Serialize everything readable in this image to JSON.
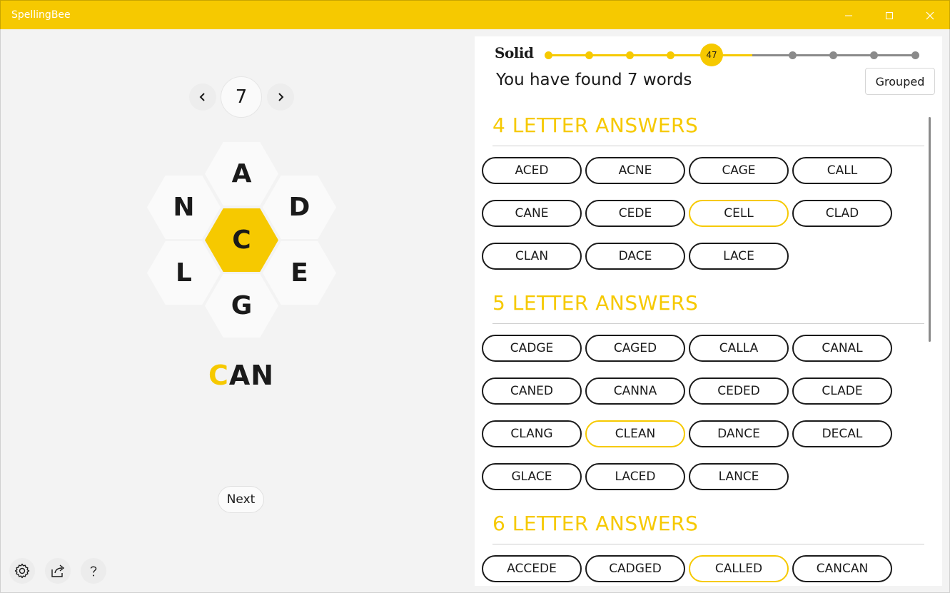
{
  "window": {
    "title": "SpellingBee"
  },
  "left": {
    "puzzle_number": "7",
    "letters": {
      "top": "A",
      "upper_left": "N",
      "upper_right": "D",
      "center": "C",
      "lower_left": "L",
      "lower_right": "E",
      "bottom": "G"
    },
    "current_word": {
      "first_letter": "C",
      "rest": "AN"
    },
    "next_label": "Next"
  },
  "right": {
    "rank": "Solid",
    "score": "47",
    "found_text": "You have found 7 words",
    "grouped_label": "Grouped",
    "progress": {
      "steps": 10,
      "current_step": 5
    },
    "sections": [
      {
        "title": "4 LETTER ANSWERS",
        "words": [
          "ACED",
          "ACNE",
          "CAGE",
          "CALL",
          "CANE",
          "CEDE",
          "CELL",
          "CLAD",
          "CLAN",
          "DACE",
          "LACE"
        ],
        "highlighted": [
          "CELL"
        ]
      },
      {
        "title": "5 LETTER ANSWERS",
        "words": [
          "CADGE",
          "CAGED",
          "CALLA",
          "CANAL",
          "CANED",
          "CANNA",
          "CEDED",
          "CLADE",
          "CLANG",
          "CLEAN",
          "DANCE",
          "DECAL",
          "GLACE",
          "LACED",
          "LANCE"
        ],
        "highlighted": [
          "CLEAN"
        ]
      },
      {
        "title": "6 LETTER ANSWERS",
        "words": [
          "ACCEDE",
          "CADGED",
          "CALLED",
          "CANCAN"
        ],
        "highlighted": [
          "CALLED"
        ]
      }
    ]
  },
  "colors": {
    "accent": "#f6c900",
    "text": "#1a1a1a",
    "bg": "#f3f3f3"
  },
  "icons": [
    "minimize-icon",
    "maximize-icon",
    "close-icon",
    "chevron-left-icon",
    "chevron-right-icon",
    "settings-icon",
    "share-icon",
    "help-icon"
  ]
}
